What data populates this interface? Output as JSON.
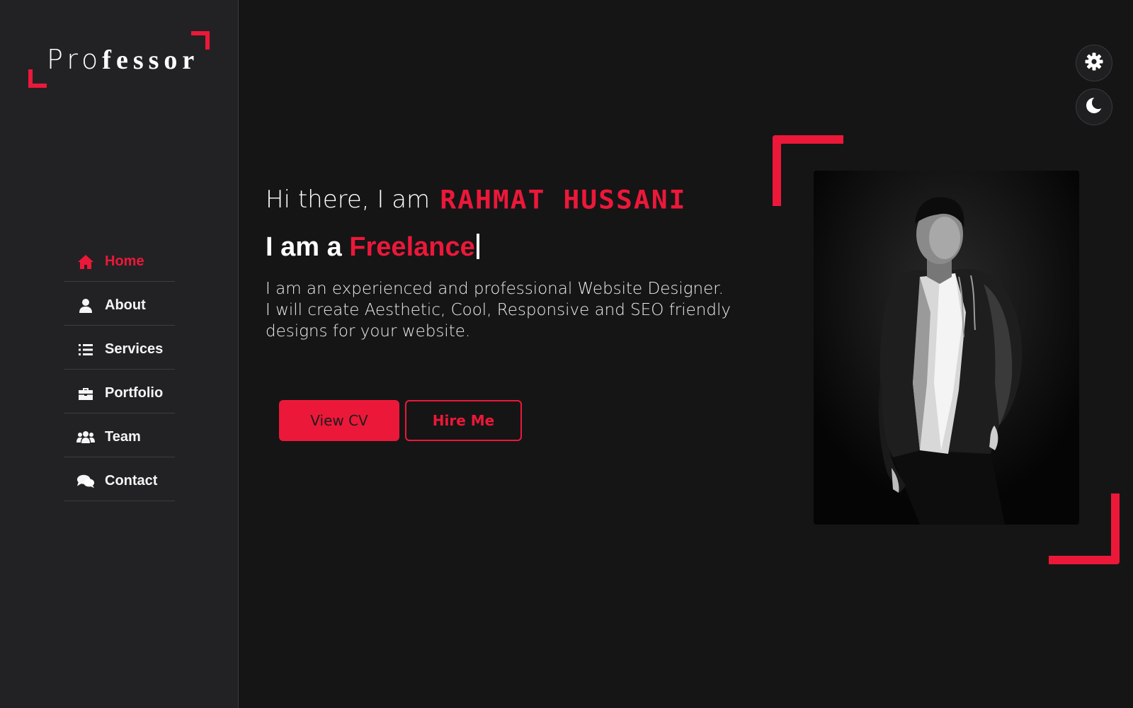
{
  "logo": {
    "light_text": "Pro",
    "bold_text": "fessor"
  },
  "nav": {
    "items": [
      {
        "label": "Home",
        "icon": "home-icon",
        "active": true
      },
      {
        "label": "About",
        "icon": "user-icon",
        "active": false
      },
      {
        "label": "Services",
        "icon": "list-icon",
        "active": false
      },
      {
        "label": "Portfolio",
        "icon": "briefcase-icon",
        "active": false
      },
      {
        "label": "Team",
        "icon": "users-icon",
        "active": false
      },
      {
        "label": "Contact",
        "icon": "comments-icon",
        "active": false
      }
    ]
  },
  "hero": {
    "greeting": "Hi there, I am",
    "name": "RAHMAT HUSSANI",
    "role_prefix": "I am a",
    "role": "Freelance",
    "description": "I am an experienced and professional Website Designer. I will create Aesthetic, Cool, Responsive and SEO friendly designs for your website."
  },
  "buttons": {
    "view_cv": "View CV",
    "hire_me": "Hire Me"
  },
  "controls": {
    "settings_icon": "gear-icon",
    "theme_icon": "moon-icon"
  },
  "colors": {
    "accent": "#ec1839",
    "background": "#151516",
    "sidebar": "#222224",
    "text": "#ffffff"
  }
}
